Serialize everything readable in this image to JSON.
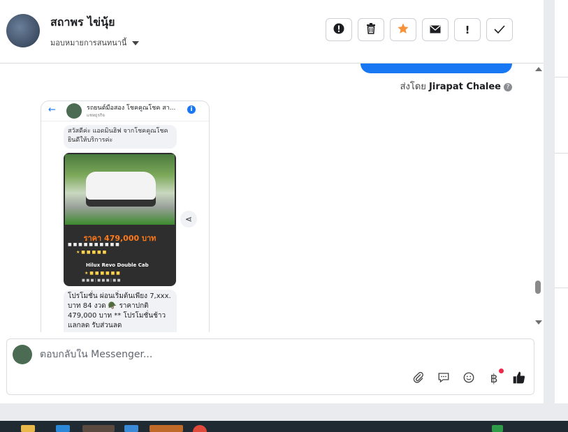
{
  "header": {
    "contact_name": "สถาพร ไข่นุ้ย",
    "assign_label": "มอบหมายการสนทนานี้"
  },
  "actions": [
    {
      "icon": "alert-circle-icon",
      "glyph": "❗"
    },
    {
      "icon": "trash-icon",
      "glyph": "🗑"
    },
    {
      "icon": "star-icon",
      "glyph": "★"
    },
    {
      "icon": "mail-icon",
      "glyph": "✉"
    },
    {
      "icon": "exclamation-icon",
      "glyph": "!"
    },
    {
      "icon": "check-icon",
      "glyph": "✓"
    }
  ],
  "messages": {
    "sent_by_label": "ส่งโดย",
    "sent_by_name": "Jirapat Chalee",
    "shared_card": {
      "page_title": "รถยนต์มือสอง โชคคูณโชค สา...",
      "page_subtitle": "แชทธุรกิจ",
      "greeting": "สวัสดีค่ะ แอดมินฮิฟ จากโชคคูณโชคยินดีให้บริการค่ะ",
      "price": "ราคา 479,000 บาท",
      "model": "Hilux Revo Double Cab",
      "description": "โปรโมชั่น ผ่อนเริ่มต้นเพียง 7,xxx. บาท 84 งวด 🪖 ราคาปกติ 479,000 บาท ** โปรโมชั่นช้าวแลกลด รับส่วนลด"
    }
  },
  "reply": {
    "placeholder": "ตอบกลับใน Messenger..."
  },
  "tools": [
    {
      "icon": "attachment-icon",
      "glyph": "📎"
    },
    {
      "icon": "saved-replies-icon",
      "glyph": "💬"
    },
    {
      "icon": "emoji-icon",
      "glyph": "☺"
    },
    {
      "icon": "baht-payment-icon",
      "glyph": "฿"
    },
    {
      "icon": "thumbs-up-icon",
      "glyph": "👍"
    }
  ],
  "colors": {
    "accent": "#1877f2",
    "star": "#f7923a",
    "notification": "#f02849"
  }
}
